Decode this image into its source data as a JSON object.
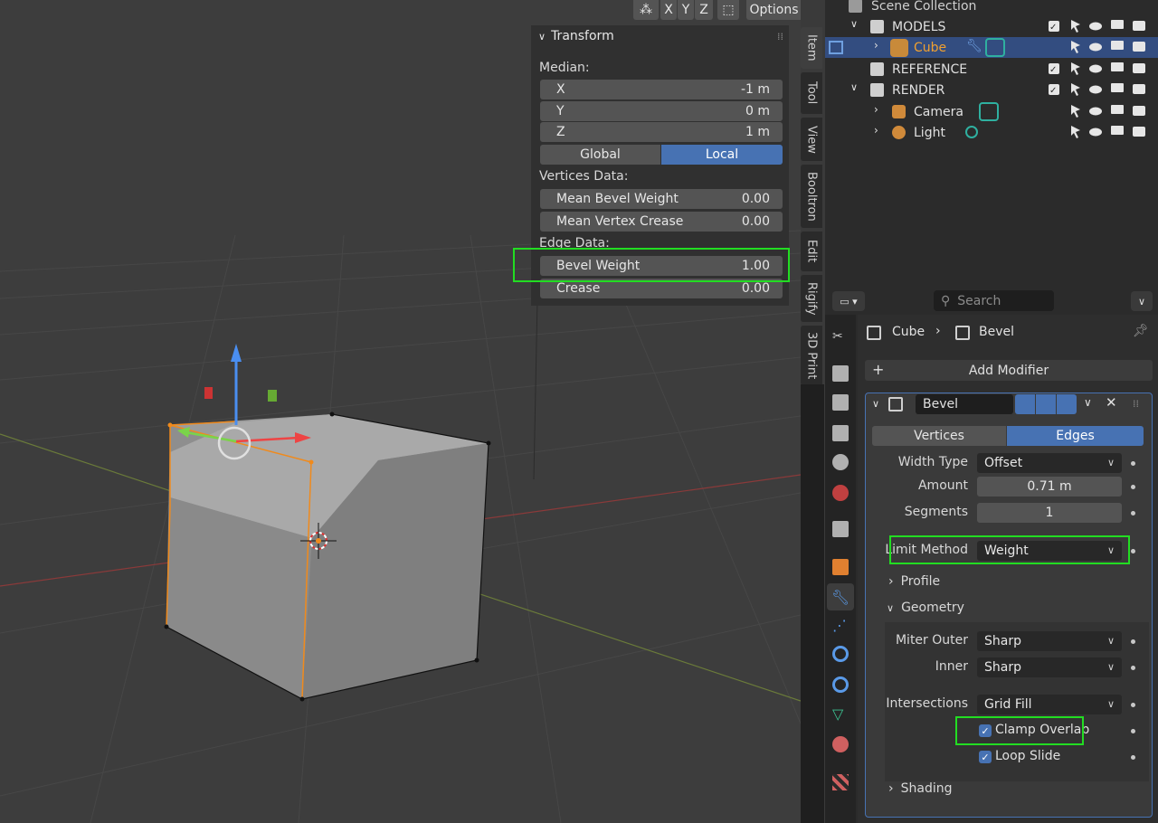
{
  "viewport_header": {
    "x_axis": "X",
    "y_axis": "Y",
    "z_axis": "Z",
    "options": "Options"
  },
  "npanel": {
    "title": "Transform",
    "median_label": "Median:",
    "x": {
      "label": "X",
      "value": "-1 m"
    },
    "y": {
      "label": "Y",
      "value": "0 m"
    },
    "z": {
      "label": "Z",
      "value": "1 m"
    },
    "global": "Global",
    "local": "Local",
    "vertices_data_label": "Vertices Data:",
    "mean_bevel_weight": {
      "label": "Mean Bevel Weight",
      "value": "0.00"
    },
    "mean_vertex_crease": {
      "label": "Mean Vertex Crease",
      "value": "0.00"
    },
    "edge_data_label": "Edge Data:",
    "bevel_weight": {
      "label": "Bevel Weight",
      "value": "1.00"
    },
    "crease": {
      "label": "Crease",
      "value": "0.00"
    }
  },
  "vtabs": [
    "Item",
    "Tool",
    "View",
    "Booltron",
    "Edit",
    "Rigify",
    "3D Print"
  ],
  "outliner": {
    "scene_collection": "Scene Collection",
    "models": "MODELS",
    "cube": "Cube",
    "reference": "REFERENCE",
    "render": "RENDER",
    "camera": "Camera",
    "light": "Light"
  },
  "properties": {
    "search_placeholder": "Search",
    "breadcrumb_object": "Cube",
    "breadcrumb_modifier": "Bevel",
    "add_modifier": "Add Modifier",
    "modifier_name": "Bevel",
    "vertices_tab": "Vertices",
    "edges_tab": "Edges",
    "width_type": {
      "label": "Width Type",
      "value": "Offset"
    },
    "amount": {
      "label": "Amount",
      "value": "0.71 m"
    },
    "segments": {
      "label": "Segments",
      "value": "1"
    },
    "limit_method": {
      "label": "Limit Method",
      "value": "Weight"
    },
    "profile": "Profile",
    "geometry": "Geometry",
    "miter_outer": {
      "label": "Miter Outer",
      "value": "Sharp"
    },
    "inner": {
      "label": "Inner",
      "value": "Sharp"
    },
    "intersections": {
      "label": "Intersections",
      "value": "Grid Fill"
    },
    "clamp_overlap": "Clamp Overlap",
    "loop_slide": "Loop Slide",
    "shading": "Shading"
  },
  "colors": {
    "highlight": "#22dd22",
    "accent": "#4772b3",
    "selected_row": "#334d80"
  }
}
